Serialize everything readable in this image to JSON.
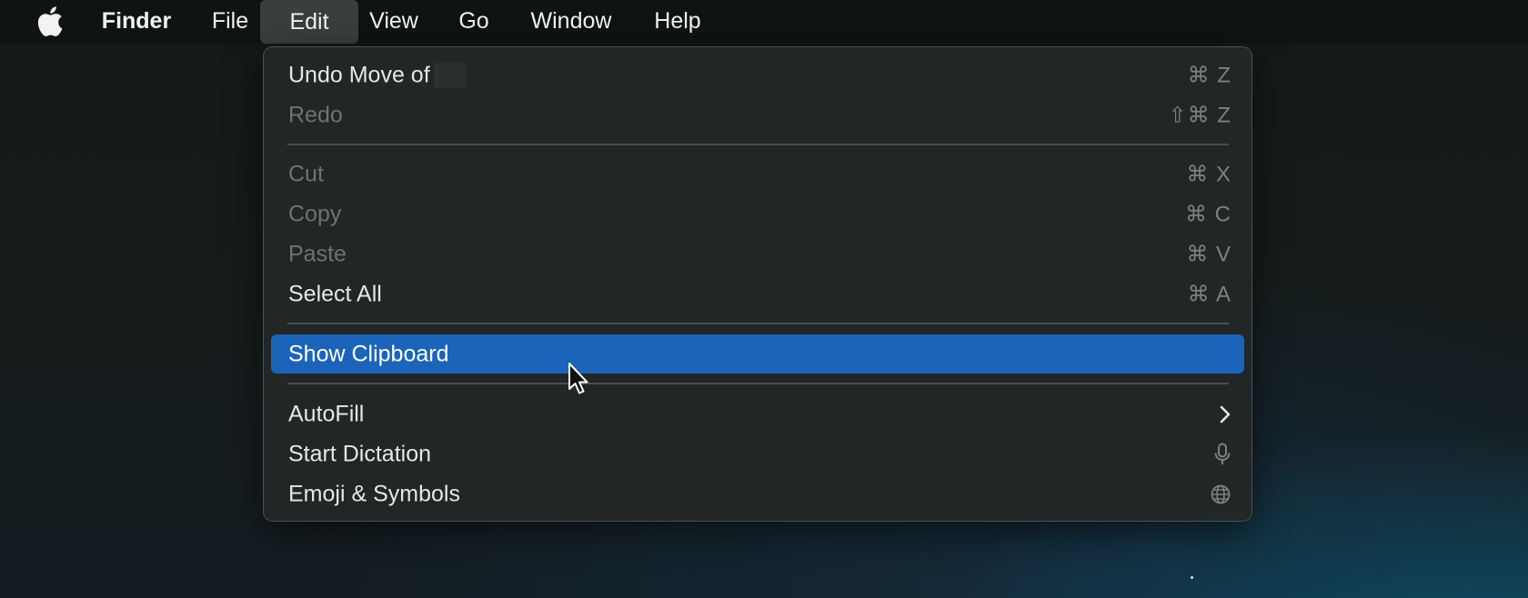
{
  "menubar": {
    "apple_icon": "apple-logo-icon",
    "items": [
      {
        "label": "Finder"
      },
      {
        "label": "File"
      },
      {
        "label": "Edit"
      },
      {
        "label": "View"
      },
      {
        "label": "Go"
      },
      {
        "label": "Window"
      },
      {
        "label": "Help"
      }
    ],
    "active_item": "Edit"
  },
  "edit_menu": {
    "items": [
      {
        "label": "Undo Move of",
        "shortcut": "⌘ Z",
        "enabled": true
      },
      {
        "label": "Redo",
        "shortcut": "⇧⌘ Z",
        "enabled": false
      },
      {
        "label": "Cut",
        "shortcut": "⌘ X",
        "enabled": false
      },
      {
        "label": "Copy",
        "shortcut": "⌘ C",
        "enabled": false
      },
      {
        "label": "Paste",
        "shortcut": "⌘ V",
        "enabled": false
      },
      {
        "label": "Select All",
        "shortcut": "⌘ A",
        "enabled": true
      },
      {
        "label": "Show Clipboard",
        "shortcut": "",
        "enabled": true,
        "highlighted": true
      },
      {
        "label": "AutoFill",
        "icon": "chevron-right-icon",
        "enabled": true
      },
      {
        "label": "Start Dictation",
        "icon": "microphone-icon",
        "enabled": true
      },
      {
        "label": "Emoji & Symbols",
        "icon": "globe-icon",
        "enabled": true
      }
    ]
  },
  "colors": {
    "highlight": "#1c64b9",
    "menu_background": "#232726",
    "menubar_background": "#0f1412"
  }
}
